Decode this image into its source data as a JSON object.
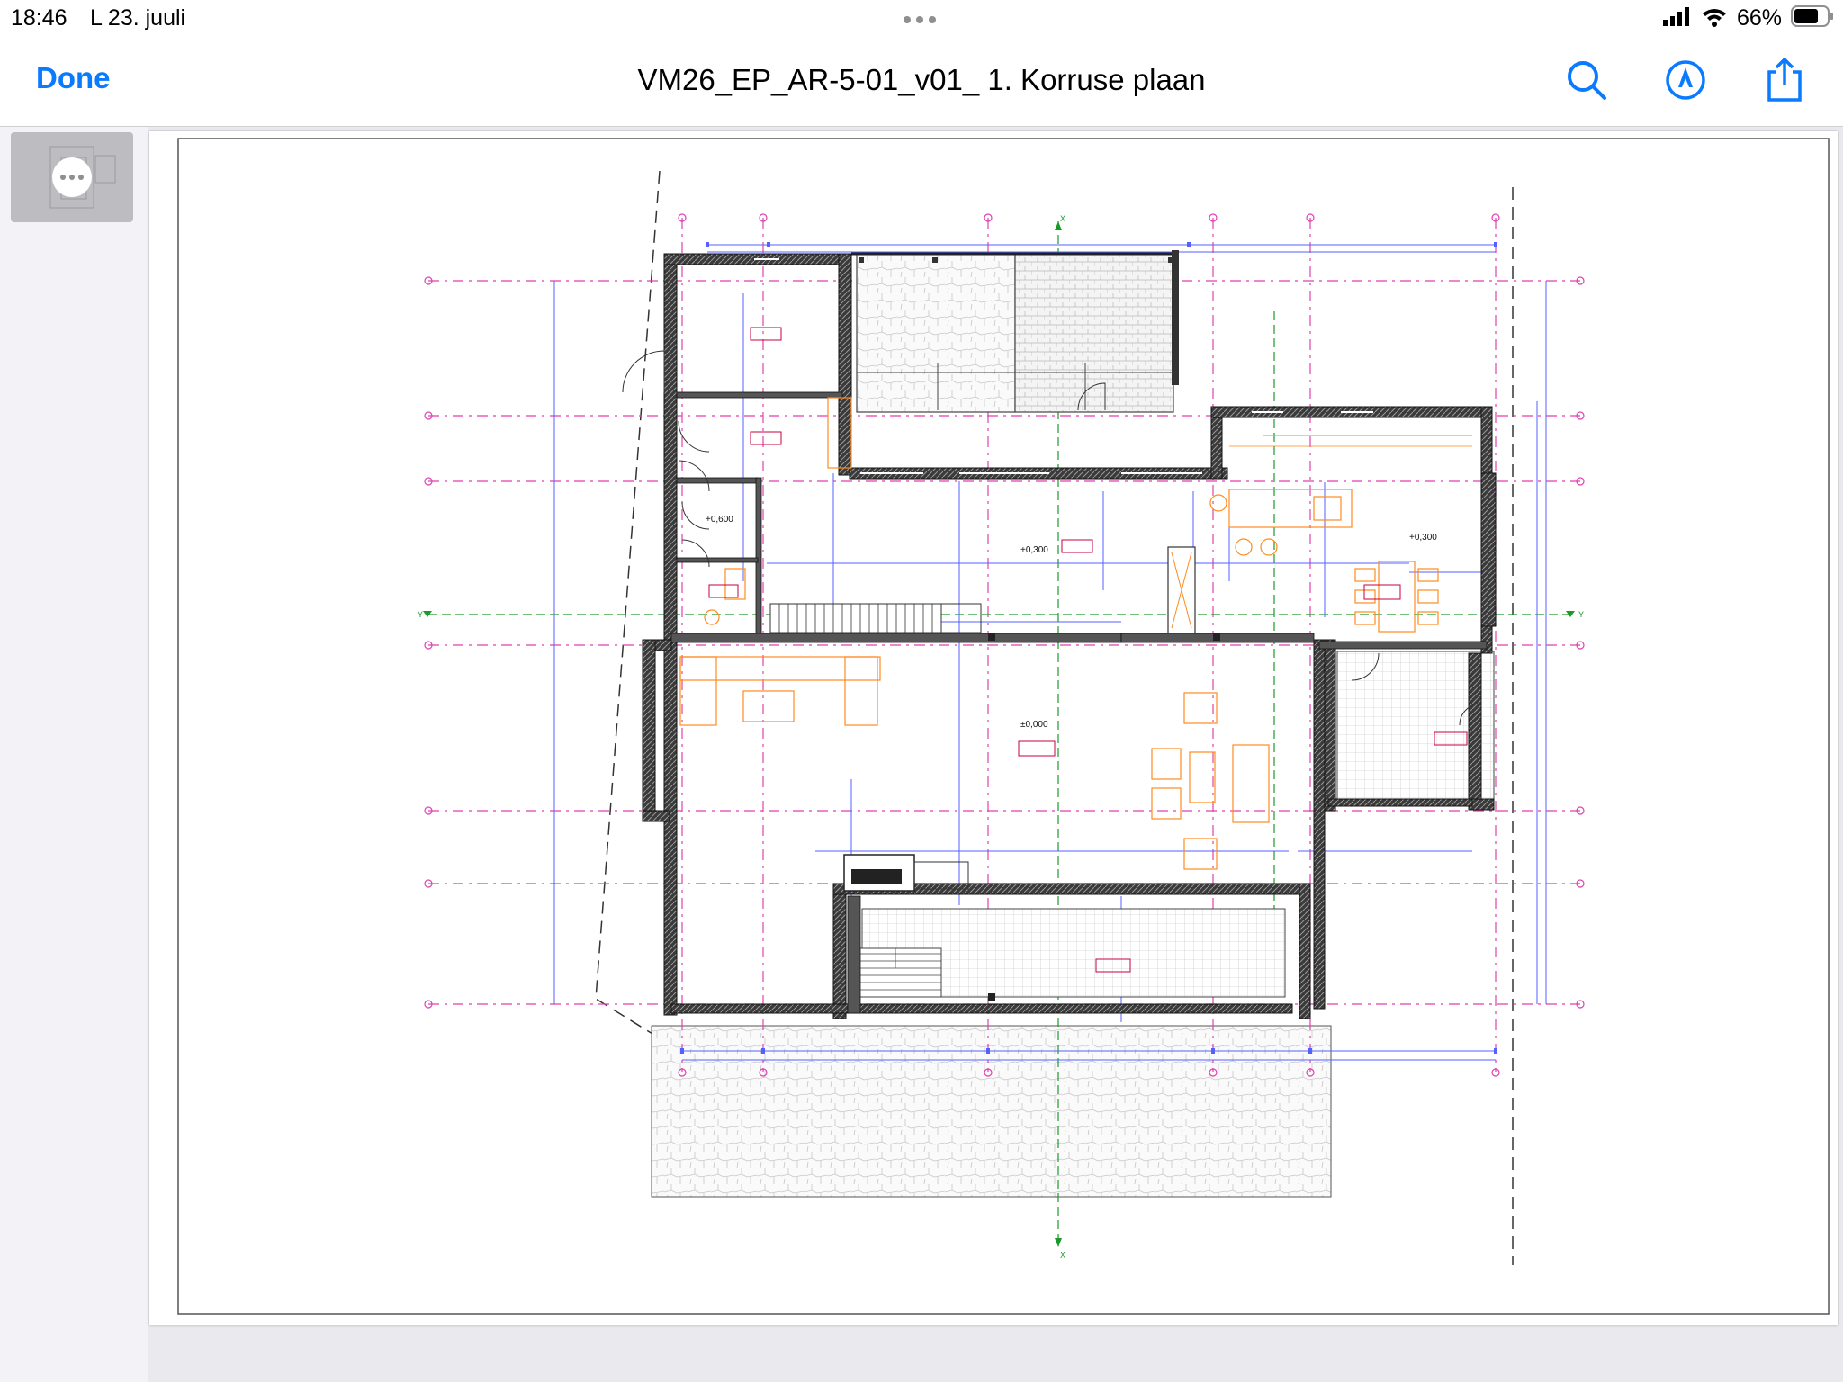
{
  "status_bar": {
    "time": "18:46",
    "date": "L 23. juuli",
    "battery_text": "66%"
  },
  "nav": {
    "done_label": "Done",
    "title": "VM26_EP_AR-5-01_v01_ 1. Korruse plaan",
    "icons": [
      "search-icon",
      "markup-icon",
      "share-icon"
    ],
    "accent_color": "#0a7aff"
  },
  "sidebar": {
    "thumbnail_icon": "more-icon"
  },
  "plan": {
    "levels": [
      "+0,600",
      "+0,300",
      "+0,300",
      "±0,000"
    ],
    "axis_labels": [
      "Y",
      "Y",
      "X",
      "X"
    ],
    "colors": {
      "grid": "#e23fb0",
      "dimension": "#5560ff",
      "furniture": "#ff8a1e",
      "room_tag": "#c4003c",
      "axis": "#1a9a2a"
    }
  }
}
